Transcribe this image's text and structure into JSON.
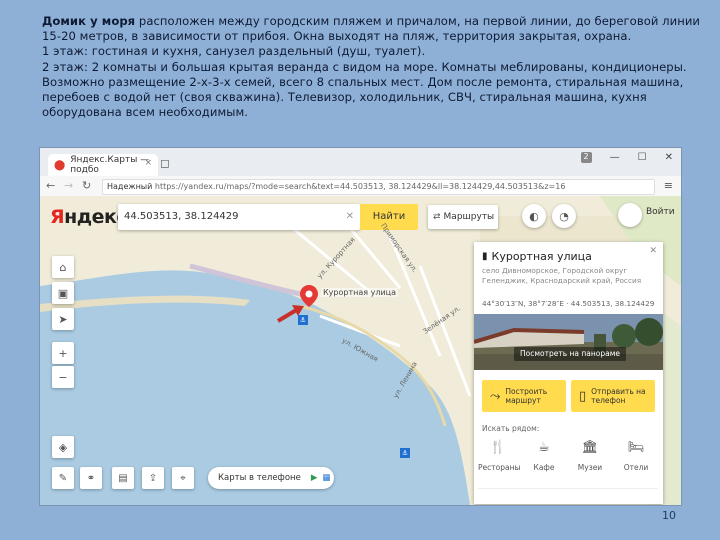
{
  "description": {
    "bold_lead": "Домик у моря",
    "line1_rest": " расположен между городским пляжем и причалом, на первой линии, до береговой линии 15-20 метров, в зависимости от прибоя. Окна выходят на пляж, территория закрытая, охрана.",
    "line2": "1 этаж: гостиная и кухня, санузел раздельный (душ, туалет).",
    "line3": "2 этаж: 2 комнаты и большая крытая веранда с видом на море. Комнаты меблированы, кондиционеры. Возможно размещение 2-х-3-х семей, всего 8 спальных мест. Дом после ремонта, стиральная машина, перебоев с водой нет (своя скважина). Телевизор, холодильник, СВЧ, стиральная машина, кухня оборудована всем необходимым."
  },
  "slide_number": "10",
  "browser": {
    "tab_title": "Яндекс.Карты — подбо",
    "tab_close": "×",
    "new_tab": "◻",
    "window_badge": "2",
    "win_min": "—",
    "win_max": "☐",
    "win_close": "✕",
    "back": "←",
    "reload": "↻",
    "url_security": "Надежный",
    "url": "https://yandex.ru/maps/?mode=search&text=44.503513, 38.124429&ll=38.124429,44.503513&z=16",
    "menu": "≡"
  },
  "map": {
    "logo_first": "Я",
    "logo_rest": "ндекс",
    "search_value": "44.503513, 38.124429",
    "clear_icon": "✕",
    "find_label": "Найти",
    "route_label": "Маршруты",
    "enter_label": "Войти",
    "pin_label": "Курортная улица",
    "street_labels": [
      "ул. Курортная",
      "Приморская ул.",
      "Зелёная ул.",
      "ул. Ленина",
      "ул. Южная"
    ],
    "left_controls": [
      "⌂",
      "▣",
      "➤",
      "+",
      "−",
      "◈"
    ],
    "bottom_tools": [
      "✎",
      "⚭",
      "▤",
      "⇪",
      "⌖"
    ],
    "phone_label": "Карты в телефоне",
    "phone_icons": [
      "",
      "▶",
      "▦"
    ]
  },
  "card": {
    "title": "Курортная улица",
    "close": "✕",
    "subtitle": "село Дивноморское, Городской округ Геленджик, Краснодарский край, Россия",
    "coords": "44°30′13″N, 38°7′28″E  ·  44.503513, 38.124429",
    "pano_button": "Посмотреть на панораме",
    "route_button": "Построить маршрут",
    "phone_button": "Отправить на телефон",
    "nearby_label": "Искать рядом:",
    "categories": [
      {
        "icon": "🍴",
        "label": "Рестораны"
      },
      {
        "icon": "☕",
        "label": "Кафе"
      },
      {
        "icon": "🏛",
        "label": "Музеи"
      },
      {
        "icon": "🛏",
        "label": "Отели"
      }
    ]
  },
  "colors": {
    "slide_bg": "#8fb0d6",
    "yandex_red": "#e52620",
    "yandex_yellow": "#ffdb4d",
    "sea": "#aacbe2",
    "land": "#f0ecd9"
  }
}
